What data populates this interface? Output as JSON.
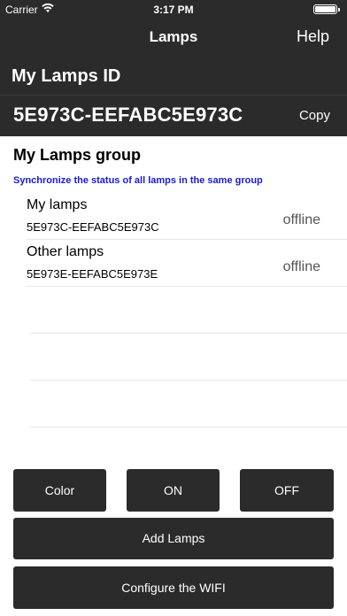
{
  "status_bar": {
    "carrier": "Carrier",
    "time": "3:17 PM",
    "battery_level": 1.0
  },
  "nav": {
    "title": "Lamps",
    "help_label": "Help"
  },
  "my_lamps": {
    "label": "My Lamps ID",
    "id_value": "5E973C-EEFABC5E973C",
    "copy_label": "Copy"
  },
  "group": {
    "title": "My Lamps group",
    "subtitle": "Synchronize the status of all lamps in the same group",
    "lamps": [
      {
        "name": "My lamps",
        "id": "5E973C-EEFABC5E973C",
        "status": "offline"
      },
      {
        "name": "Other lamps",
        "id": "5E973E-EEFABC5E973E",
        "status": "offline"
      }
    ]
  },
  "buttons": {
    "color": "Color",
    "on": "ON",
    "off": "OFF",
    "add_lamps": "Add Lamps",
    "configure_wifi": "Configure the WIFI"
  },
  "colors": {
    "bar_background": "#2b2b2b",
    "subtitle_blue": "#1a1ad6"
  }
}
